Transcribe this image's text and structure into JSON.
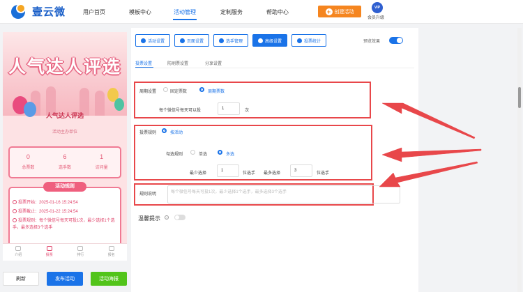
{
  "app": {
    "brand": "壹云微",
    "nav": [
      "用户首页",
      "模板中心",
      "活动管理",
      "定制服务",
      "帮助中心"
    ],
    "nav_active": 2,
    "create_label": "创建活动",
    "vip_badge": "VIP",
    "vip_label": "会员升级",
    "accent_color": "#1a73e8",
    "create_color": "#f5851f"
  },
  "preview": {
    "banner_title": "人气达人评选",
    "event_name": "人气达人评选",
    "host": "活动主办单位",
    "stats": [
      {
        "value": "0",
        "label": "总票数"
      },
      {
        "value": "6",
        "label": "选手数"
      },
      {
        "value": "1",
        "label": "访问量"
      }
    ],
    "rules_title": "活动规则",
    "rules": [
      "投票开始：2025-01-16 15:24:54",
      "投票截止：2025-01-22 15:24:54",
      "投票规则：每个微信号每天可投1次，最少选择1个选手，最多选择3个选手"
    ],
    "tabs": [
      "介绍",
      "投票",
      "排行",
      "报名"
    ],
    "active_tab": 1
  },
  "bottom_buttons": {
    "refresh": "刷新",
    "publish": "发布活动",
    "poster": "活动海报"
  },
  "settings": {
    "toolbar": [
      "活动设置",
      "页面设置",
      "选手管理",
      "高级设置",
      "投票统计"
    ],
    "toolbar_active": 3,
    "preview_toggle_label": "预览效果",
    "preview_toggle_on": true,
    "subtabs": [
      "投票设置",
      "防刷票设置",
      "分享设置"
    ],
    "subtab_active": 0,
    "cycle": {
      "label": "周期设置",
      "options": [
        "固定票数",
        "周期票数"
      ],
      "selected": 1,
      "per_wechat_label": "每个微信号每天可以投",
      "per_wechat_value": "1",
      "unit": "次"
    },
    "vote_rule": {
      "label": "投票规则",
      "option": "按活动",
      "check_rule_label": "勾选规则",
      "check_options": [
        "单选",
        "多选"
      ],
      "check_selected": 1,
      "min_label": "最少选择",
      "min_value": "1",
      "min_unit": "位选手",
      "max_label": "最多选择",
      "max_value": "3",
      "max_unit": "位选手"
    },
    "rule_desc": {
      "label": "规则说明",
      "value": "每个微信号每天可投1次，最少选择1个选手，最多选择3个选手"
    },
    "tip": {
      "label": "温馨提示",
      "icon": "?",
      "on": false
    }
  }
}
